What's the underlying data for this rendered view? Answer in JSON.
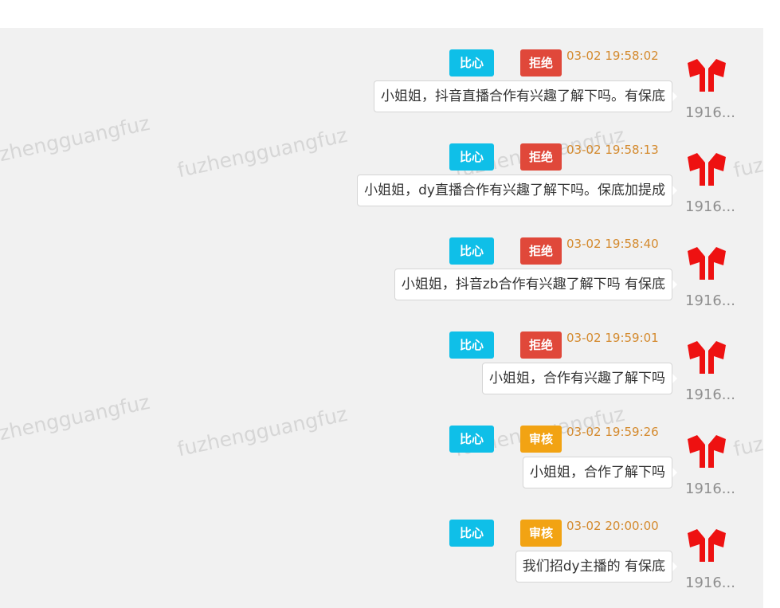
{
  "watermark": "fuzhengguangfuz",
  "messages": [
    {
      "bixin": "比心",
      "status": "拒绝",
      "status_type": "reject",
      "time": "03-02 19:58:02",
      "text": "小姐姐，抖音直播合作有兴趣了解下吗。有保底",
      "sender": "1916..."
    },
    {
      "bixin": "比心",
      "status": "拒绝",
      "status_type": "reject",
      "time": "03-02 19:58:13",
      "text": "小姐姐，dy直播合作有兴趣了解下吗。保底加提成",
      "sender": "1916..."
    },
    {
      "bixin": "比心",
      "status": "拒绝",
      "status_type": "reject",
      "time": "03-02 19:58:40",
      "text": "小姐姐，抖音zb合作有兴趣了解下吗 有保底",
      "sender": "1916..."
    },
    {
      "bixin": "比心",
      "status": "拒绝",
      "status_type": "reject",
      "time": "03-02 19:59:01",
      "text": "小姐姐，合作有兴趣了解下吗",
      "sender": "1916..."
    },
    {
      "bixin": "比心",
      "status": "审核",
      "status_type": "review",
      "time": "03-02 19:59:26",
      "text": "小姐姐，合作了解下吗",
      "sender": "1916..."
    },
    {
      "bixin": "比心",
      "status": "审核",
      "status_type": "review",
      "time": "03-02 20:00:00",
      "text": "我们招dy主播的 有保底",
      "sender": "1916..."
    }
  ],
  "colors": {
    "bixin_tag": "#0fbfe8",
    "reject_tag": "#e0483a",
    "review_tag": "#f2a313",
    "timestamp": "#d48a2e",
    "avatar_logo": "#ee1111"
  },
  "icons": {
    "avatar": "red-logo-avatar-icon"
  }
}
